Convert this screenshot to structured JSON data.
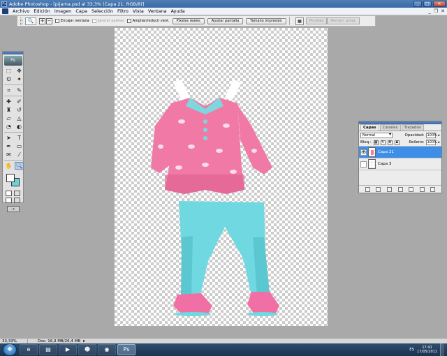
{
  "window": {
    "title": "Adobe Photoshop - [pijama.psd al 33,3% (Capa 21, RGB/8)]",
    "controls": {
      "minimize": "_",
      "maximize": "□",
      "close": "✕"
    }
  },
  "menubar": {
    "items": [
      "Archivo",
      "Edición",
      "Imagen",
      "Capa",
      "Selección",
      "Filtro",
      "Vista",
      "Ventana",
      "Ayuda"
    ],
    "mdi_controls": {
      "minimize": "_",
      "restore": "❐",
      "close": "✕"
    }
  },
  "options_bar": {
    "tool_preset_icon": "magnifier-icon",
    "tool_preset_glyph": "🔍",
    "zoom_in": "+",
    "zoom_out": "−",
    "checkboxes": [
      {
        "label": "Encajar ventana",
        "enabled": true
      },
      {
        "label": "Ignorar paletas",
        "enabled": false
      },
      {
        "label": "Ampliar/reducir vent.",
        "enabled": true
      }
    ],
    "buttons": [
      "Píxeles reales",
      "Ajustar pantalla",
      "Tamaño impresión"
    ],
    "palette_well_tabs": [
      "Pinceles",
      "Herram. preaj."
    ]
  },
  "tools": {
    "logo_text": "Ps",
    "items": [
      {
        "icon": "marquee-icon",
        "glyph": "⬚"
      },
      {
        "icon": "move-icon",
        "glyph": "✥"
      },
      {
        "icon": "lasso-icon",
        "glyph": "ʘ"
      },
      {
        "icon": "magic-wand-icon",
        "glyph": "✦"
      },
      {
        "icon": "crop-icon",
        "glyph": "⌗"
      },
      {
        "icon": "slice-icon",
        "glyph": "✎"
      },
      {
        "icon": "healing-brush-icon",
        "glyph": "✚"
      },
      {
        "icon": "brush-icon",
        "glyph": "✐"
      },
      {
        "icon": "clone-stamp-icon",
        "glyph": "♜"
      },
      {
        "icon": "history-brush-icon",
        "glyph": "↺"
      },
      {
        "icon": "eraser-icon",
        "glyph": "▱"
      },
      {
        "icon": "paint-bucket-icon",
        "glyph": "◬"
      },
      {
        "icon": "blur-icon",
        "glyph": "◔"
      },
      {
        "icon": "dodge-icon",
        "glyph": "◐"
      },
      {
        "icon": "path-selection-icon",
        "glyph": "➤"
      },
      {
        "icon": "type-icon",
        "glyph": "T"
      },
      {
        "icon": "pen-icon",
        "glyph": "✒"
      },
      {
        "icon": "shape-icon",
        "glyph": "▭"
      },
      {
        "icon": "notes-icon",
        "glyph": "✉"
      },
      {
        "icon": "eyedropper-icon",
        "glyph": "⁄"
      },
      {
        "icon": "hand-icon",
        "glyph": "✋"
      },
      {
        "icon": "zoom-icon",
        "glyph": "🔍"
      }
    ],
    "foreground_color": "#ffffff",
    "background_color": "#6bd0d8",
    "jump_to_imageready": "⇢"
  },
  "document": {
    "filename": "pijama.psd",
    "zoom": "33,3%",
    "colors": {
      "shirt": "#f07aa5",
      "shirt_shade": "#dd5f8d",
      "collar": "#7fd6dd",
      "pants": "#6fd8e0",
      "pants_shade": "#4fbcc6",
      "slippers": "#f070a5",
      "hanger": "#ffffff"
    }
  },
  "layers_panel": {
    "tabs": [
      "Capas",
      "Canales",
      "Trazados"
    ],
    "active_tab": "Capas",
    "blend_mode": "Normal",
    "opacity_label": "Opacidad:",
    "opacity_value": "100%",
    "lock_label": "Bloq.:",
    "lock_icons": [
      "lock-transparency-icon",
      "lock-image-icon",
      "lock-position-icon",
      "lock-all-icon"
    ],
    "fill_label": "Relleno:",
    "fill_value": "100%",
    "layers": [
      {
        "name": "Capa 21",
        "visible": true,
        "selected": true
      },
      {
        "name": "Capa 3",
        "visible": false,
        "selected": false
      }
    ],
    "bottom_icons": [
      "link-icon",
      "layer-style-icon",
      "mask-icon",
      "adjustment-icon",
      "group-icon",
      "new-layer-icon",
      "trash-icon"
    ]
  },
  "status_bar": {
    "zoom": "33,33%",
    "doc_info": "Doc: 16,3 MB/26,4 MB",
    "arrow": "▸"
  },
  "taskbar": {
    "start_glyph": "❖",
    "apps": [
      {
        "icon": "ie-icon",
        "glyph": "e",
        "active": false
      },
      {
        "icon": "explorer-icon",
        "glyph": "▤",
        "active": false
      },
      {
        "icon": "media-player-icon",
        "glyph": "▶",
        "active": false
      },
      {
        "icon": "msn-icon",
        "glyph": "☻",
        "active": false
      },
      {
        "icon": "chrome-icon",
        "glyph": "◉",
        "active": false
      },
      {
        "icon": "photoshop-icon",
        "glyph": "Ps",
        "active": true
      }
    ],
    "language": "ES",
    "time": "17:41",
    "date": "17/05/2011"
  }
}
